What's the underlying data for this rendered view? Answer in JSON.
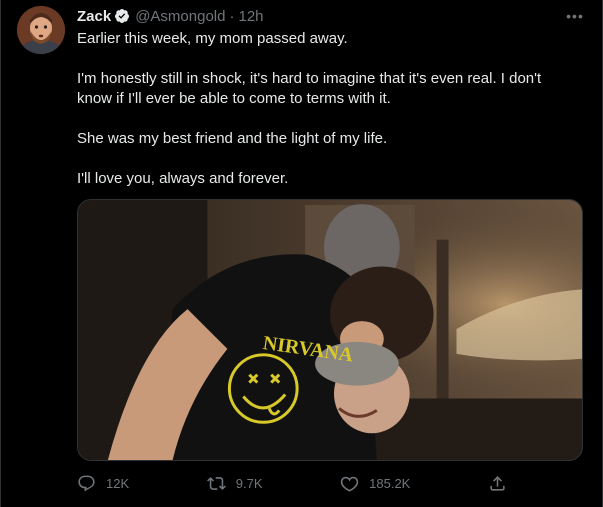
{
  "tweet": {
    "author": {
      "name": "Zack",
      "handle": "@Asmongold",
      "time": "12h",
      "separator": "·"
    },
    "more_label": "•••",
    "paragraphs": [
      "Earlier this week, my mom passed away.",
      "I'm honestly still in shock, it's hard to imagine that it's even real. I don't know if I'll ever be able to come to terms with it.",
      "She was my best friend and the light of my life.",
      "I'll love you, always and forever."
    ],
    "media": {
      "shirt_text": "NIRVANA"
    },
    "actions": {
      "replies": "12K",
      "retweets": "9.7K",
      "likes": "185.2K"
    }
  },
  "icons": {
    "verified": "verified-badge-icon",
    "reply": "reply-icon",
    "retweet": "retweet-icon",
    "like": "heart-icon",
    "share": "share-icon",
    "more": "more-icon"
  },
  "colors": {
    "background": "#000000",
    "text": "#e7e9ea",
    "muted": "#71767b",
    "border": "#2f3336",
    "shirt_print": "#d8c92a"
  }
}
